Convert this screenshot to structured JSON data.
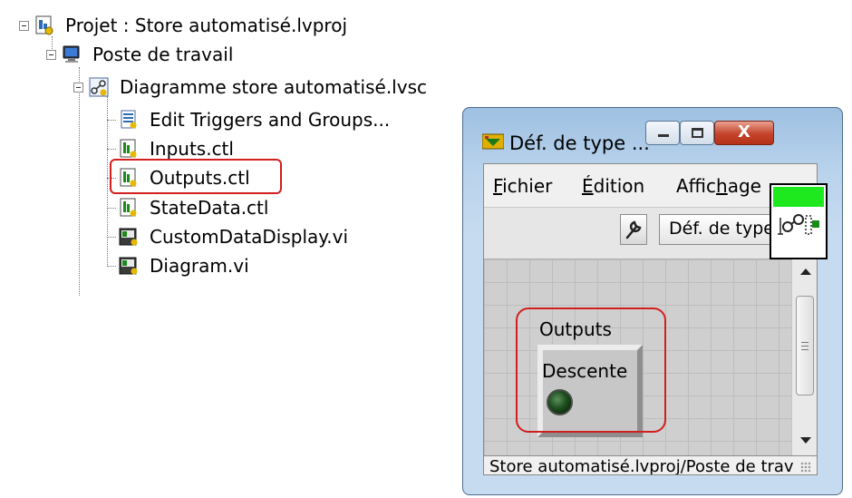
{
  "tree": {
    "items": [
      {
        "label": "Projet : Store automatisé.lvproj",
        "icon": "project-icon"
      },
      {
        "label": "Poste de travail",
        "icon": "computer-icon"
      },
      {
        "label": "Diagramme store automatisé.lvsc",
        "icon": "statechart-icon"
      },
      {
        "label": "Edit Triggers and Groups...",
        "icon": "document-icon"
      },
      {
        "label": "Inputs.ctl",
        "icon": "control-icon"
      },
      {
        "label": "Outputs.ctl",
        "icon": "control-icon"
      },
      {
        "label": "StateData.ctl",
        "icon": "control-icon"
      },
      {
        "label": "CustomDataDisplay.vi",
        "icon": "vi-icon"
      },
      {
        "label": "Diagram.vi",
        "icon": "vi-icon"
      }
    ]
  },
  "window": {
    "title": "Déf. de type ...",
    "close_glyph": "X",
    "menu": {
      "file_prefix": "F",
      "file_rest": "ichier",
      "edit_prefix": "É",
      "edit_rest": "dition",
      "view_prefix": "Affic",
      "view_hot": "h",
      "view_rest": "age"
    },
    "type_dropdown": "Déf. de type",
    "panel": {
      "cluster_label": "Outputs",
      "led_label": "Descente"
    },
    "status": "Store automatisé.lvproj/Poste de travail"
  },
  "colors": {
    "highlight": "#d21f1f",
    "led": "#1f4f1f",
    "vi_icon_green": "#1ee81e"
  }
}
